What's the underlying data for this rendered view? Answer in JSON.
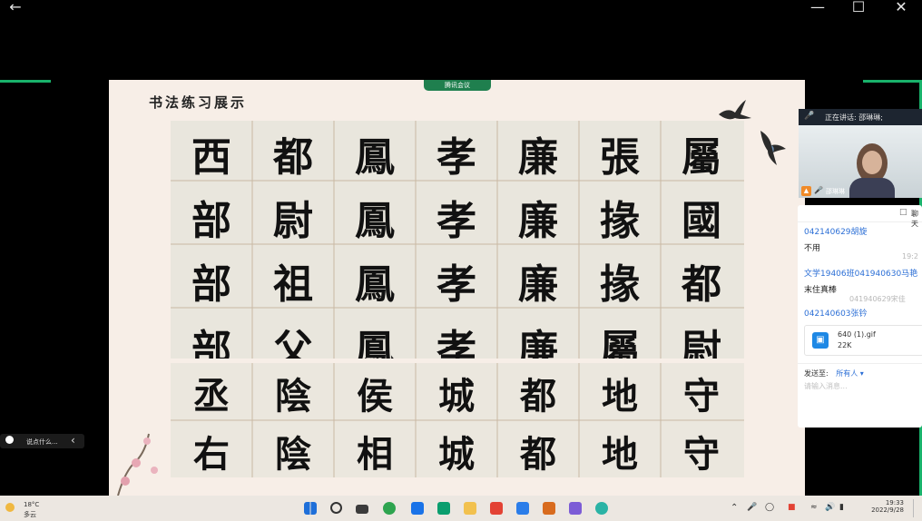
{
  "window": {
    "back_icon": "arrow-left-icon",
    "minimize_icon": "minimize-icon",
    "maximize_icon": "maximize-icon",
    "close_icon": "close-icon"
  },
  "meeting": {
    "tag_label": "腾讯会议"
  },
  "slide": {
    "title": "书法练习展示",
    "top_rows": [
      [
        "西",
        "都",
        "鳳",
        "孝",
        "廉",
        "張",
        "屬"
      ],
      [
        "部",
        "尉",
        "鳳",
        "孝",
        "廉",
        "掾",
        "國"
      ],
      [
        "部",
        "祖",
        "鳳",
        "孝",
        "廉",
        "掾",
        "都"
      ],
      [
        "部",
        "父",
        "鳳",
        "孝",
        "廉",
        "屬",
        "尉"
      ]
    ],
    "bottom_rows": [
      [
        "丞",
        "陰",
        "侯",
        "城",
        "都",
        "地",
        "守"
      ],
      [
        "右",
        "陰",
        "相",
        "城",
        "都",
        "地",
        "守"
      ]
    ]
  },
  "speaker": {
    "label": "正在讲话: 邵琳琳;",
    "name": "邵琳琳"
  },
  "chat": {
    "header": "聊天",
    "messages": [
      {
        "sender": "042140629胡旋",
        "text": "不用",
        "time": "19:2"
      },
      {
        "sender": "文学19406班041940630马艳",
        "text": "末住真棒",
        "time": ""
      },
      {
        "sender": "041940629宋佳",
        "text": "",
        "time": ""
      },
      {
        "sender": "042140603张钤",
        "text": "",
        "time": ""
      }
    ],
    "file": {
      "name": "640 (1).gif",
      "size": "22K"
    },
    "send_to_label": "发送至:",
    "send_to_value": "所有人",
    "input_placeholder": "请输入消息..."
  },
  "comment_bar": {
    "placeholder": "说点什么..."
  },
  "taskbar": {
    "weather_temp": "18°C",
    "weather_desc": "多云",
    "time": "19:33",
    "date": "2022/9/28"
  }
}
